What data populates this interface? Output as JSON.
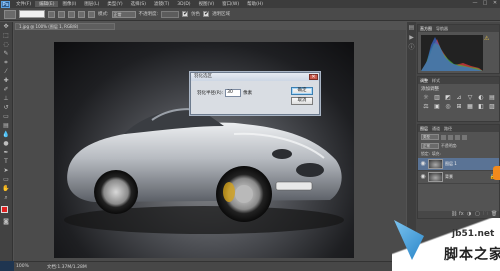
{
  "app": {
    "logo": "Ps",
    "menu": [
      "文件(F)",
      "编辑(E)",
      "图像(I)",
      "图层(L)",
      "类型(Y)",
      "选择(S)",
      "滤镜(T)",
      "3D(D)",
      "视图(V)",
      "窗口(W)",
      "帮助(H)"
    ],
    "active_menu_index": 1,
    "window_controls": [
      "—",
      "□",
      "✕"
    ]
  },
  "options_bar": {
    "mode_label": "模式:",
    "mode_value": "正常",
    "opacity_label": "不透明度:",
    "smooth_label": "平滑",
    "mirror_label": "保护细节",
    "check1": "仿色",
    "check2": "透明区域"
  },
  "document": {
    "tab_title": "1.jpg @ 100% (图层 1, RGB/8)"
  },
  "dialog": {
    "title": "羽化选区",
    "radius_label": "羽化半径(R):",
    "radius_value": "30",
    "unit": "像素",
    "ok_label": "确定",
    "cancel_label": "取消",
    "close_glyph": "✕"
  },
  "panels": {
    "histogram_tabs": [
      "直方图",
      "导航器"
    ],
    "adjustments_tabs": [
      "调整",
      "样式"
    ],
    "adjustments_title": "添加调整",
    "adjustment_icons": [
      "☼",
      "▥",
      "◩",
      "⊿",
      "▽",
      "◐",
      "▤",
      "⚖",
      "▣",
      "◎",
      "⊞",
      "▦",
      "◧",
      "▨"
    ],
    "layers_tabs": [
      "图层",
      "通道",
      "路径"
    ],
    "layer_filter_kind": "类型",
    "layer_blend_mode": "正常",
    "layer_opacity_label": "不透明度:",
    "layer_fill_label": "填充:",
    "lock_label": "锁定:",
    "layers": [
      {
        "name": "图层 1",
        "selected": true
      },
      {
        "name": "背景",
        "selected": false
      }
    ],
    "footer_icons": [
      "⛓",
      "fx",
      "◑",
      "▢",
      "🗀",
      "🗑"
    ]
  },
  "status": {
    "zoom": "100%",
    "doc_info": "文档:1.37M/1.28M"
  },
  "watermark": {
    "url": "jb51.net",
    "name": "脚本之家"
  },
  "colors": {
    "foreground": "#e02020",
    "background": "#ffffff",
    "accent": "#5a7395"
  }
}
